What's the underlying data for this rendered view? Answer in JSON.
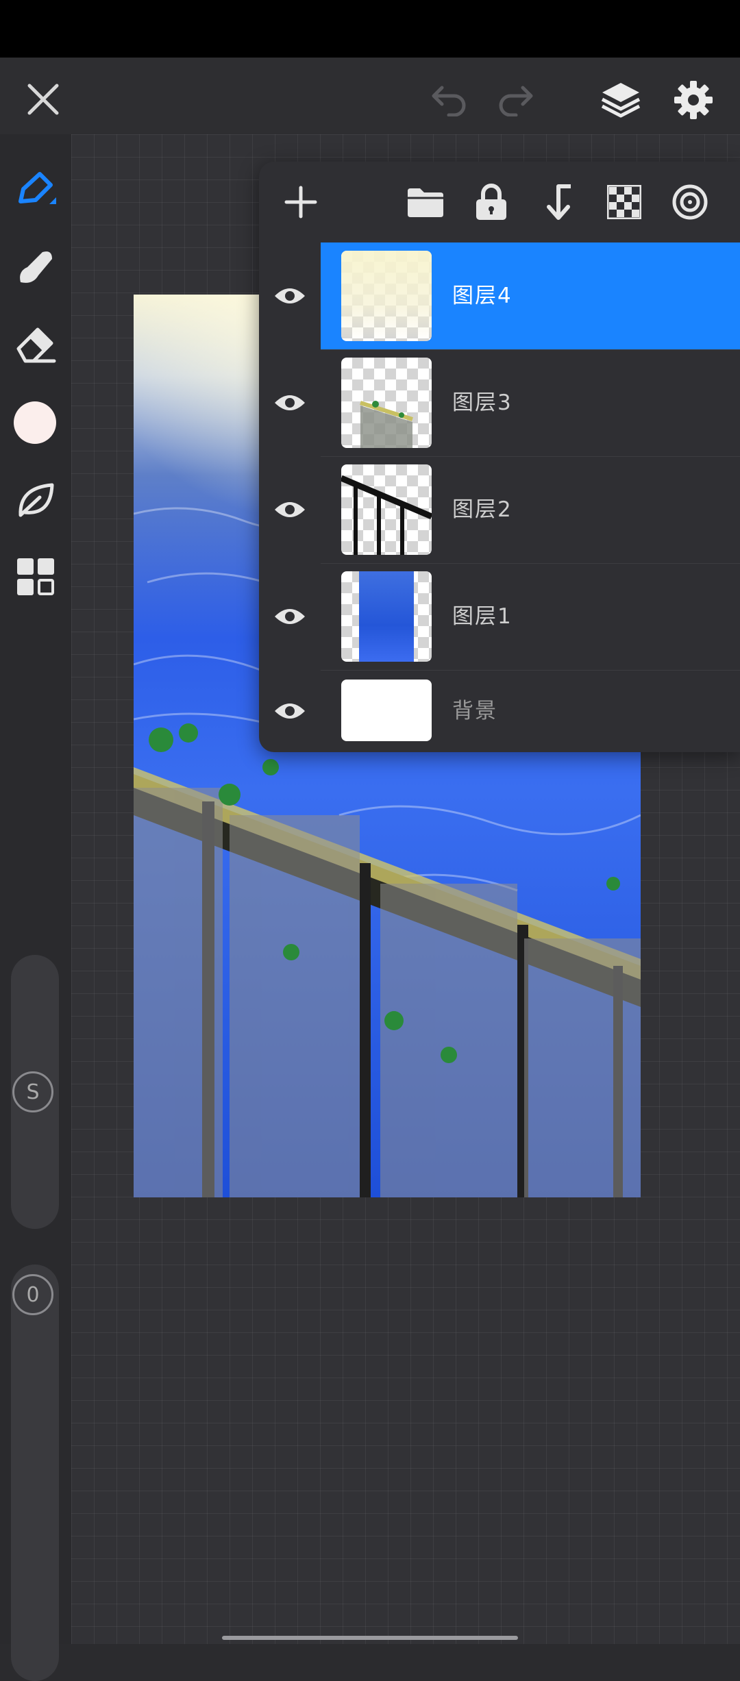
{
  "colors": {
    "accent": "#1a84ff",
    "brush_color": "#fbeeec",
    "panel_bg": "#2f2f33"
  },
  "top_bar": {
    "close_icon": "close-icon",
    "undo_icon": "undo-icon",
    "redo_icon": "redo-icon",
    "layers_icon": "layers-icon",
    "settings_icon": "gear-icon"
  },
  "sidebar": {
    "tools": [
      "pencil-tool",
      "smudge-tool",
      "eraser-tool",
      "color-swatch",
      "leaf-tool",
      "gallery-tool"
    ],
    "size_label": "S",
    "opacity_label": "0"
  },
  "layers_panel": {
    "toolbar": [
      "add-layer",
      "folder",
      "lock",
      "merge-down",
      "transparency",
      "target"
    ],
    "layers": [
      {
        "name": "图层4",
        "selected": true,
        "visible": true
      },
      {
        "name": "图层3",
        "selected": false,
        "visible": true
      },
      {
        "name": "图层2",
        "selected": false,
        "visible": true
      },
      {
        "name": "图层1",
        "selected": false,
        "visible": true
      },
      {
        "name": "背景",
        "selected": false,
        "visible": true
      }
    ]
  }
}
